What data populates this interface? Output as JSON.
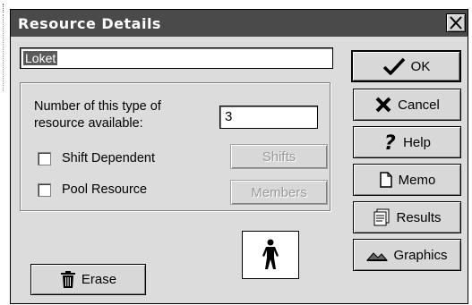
{
  "dialog": {
    "title": "Resource Details",
    "close_label": "X"
  },
  "resource": {
    "name_value": "Loket",
    "count_label_line1": "Number of this type of",
    "count_label_line2": "resource available:",
    "count_value": "3",
    "shift_dependent_label": "Shift Dependent",
    "shift_dependent_checked": false,
    "pool_resource_label": "Pool Resource",
    "pool_resource_checked": false,
    "shifts_button": "Shifts",
    "members_button": "Members"
  },
  "buttons": {
    "ok": "OK",
    "cancel": "Cancel",
    "help": "Help",
    "memo": "Memo",
    "results": "Results",
    "graphics": "Graphics",
    "erase": "Erase"
  },
  "icons": {
    "ok": "checkmark-icon",
    "cancel": "x-icon",
    "help": "question-icon",
    "memo": "document-icon",
    "results": "report-icon",
    "graphics": "graphics-icon",
    "erase": "trash-icon",
    "resource_type": "person-icon"
  }
}
